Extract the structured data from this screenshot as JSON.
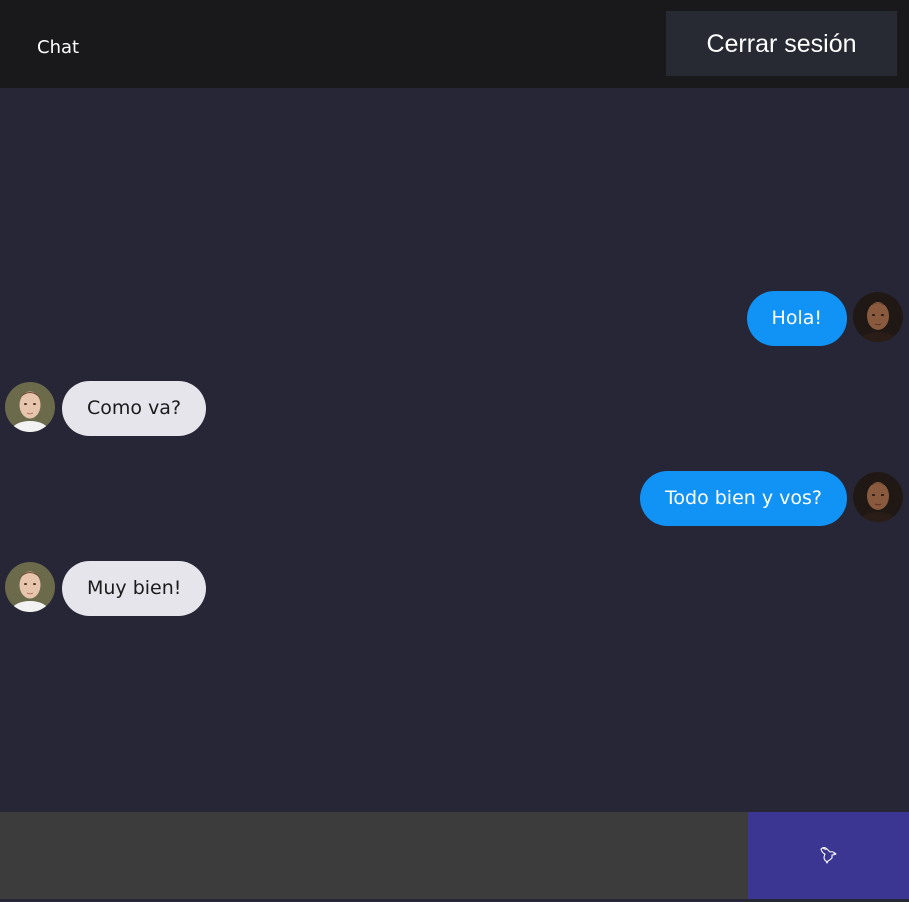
{
  "header": {
    "title": "Chat",
    "logout_label": "Cerrar sesión"
  },
  "messages": [
    {
      "sender": "me",
      "text": "Hola!"
    },
    {
      "sender": "other",
      "text": "Como va?"
    },
    {
      "sender": "me",
      "text": "Todo bien y vos?"
    },
    {
      "sender": "other",
      "text": "Muy bien!"
    }
  ],
  "composer": {
    "value": "",
    "placeholder": "",
    "send_icon": "dove-icon"
  },
  "colors": {
    "header_bg": "#19181a",
    "chat_bg": "#272637",
    "my_bubble": "#1093f5",
    "their_bubble": "#e6e5ec",
    "send_button": "#3b3691",
    "input_bg": "#3c3c3c"
  }
}
